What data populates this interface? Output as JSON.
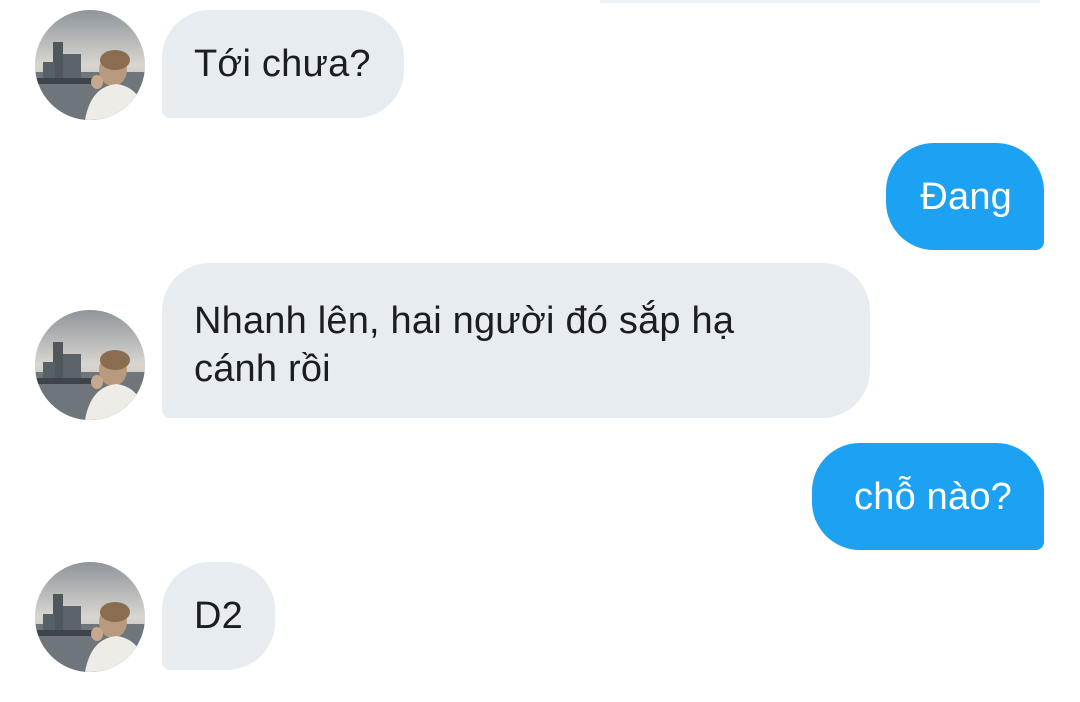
{
  "conversation": {
    "messages": [
      {
        "direction": "incoming",
        "text": "Tới chưa?",
        "avatar_icon": "profile-photo-icon"
      },
      {
        "direction": "outgoing",
        "text": "Đang"
      },
      {
        "direction": "incoming",
        "text": "Nhanh lên, hai người đó sắp hạ\ncánh rồi",
        "avatar_icon": "profile-photo-icon"
      },
      {
        "direction": "outgoing",
        "text": "chỗ nào?"
      },
      {
        "direction": "incoming",
        "text": "D2",
        "avatar_icon": "profile-photo-icon"
      }
    ]
  },
  "colors": {
    "incoming_bubble": "#e7ecf1",
    "outgoing_bubble": "#1da1f2",
    "incoming_text": "#1a1d21",
    "outgoing_text": "#ffffff"
  }
}
